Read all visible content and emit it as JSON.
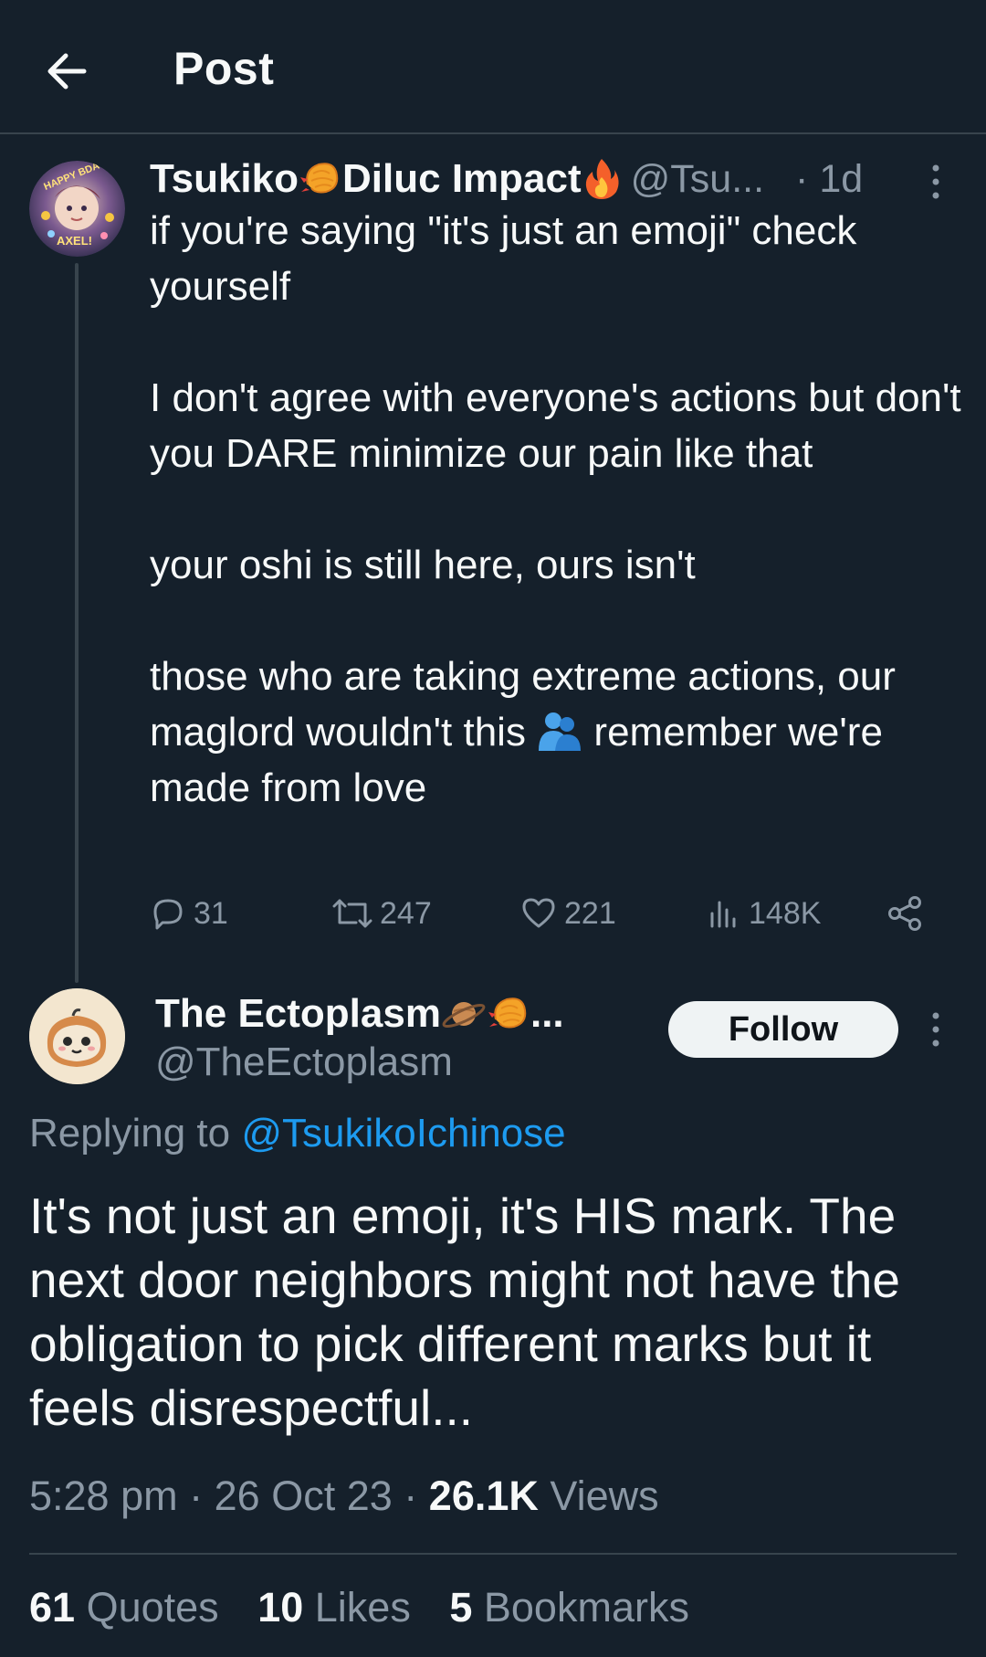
{
  "header": {
    "title": "Post"
  },
  "parent_tweet": {
    "display_name": "Tsukiko",
    "display_name_part2": "Diluc Impact",
    "handle": "@Tsu...",
    "time": "· 1d",
    "paragraphs": [
      "if you're saying \"it's just an emoji\" check yourself",
      "I don't agree with everyone's actions but don't you DARE minimize our pain like that",
      "your oshi is still here, ours isn't"
    ],
    "last_paragraph_before_emoji": "those who are taking extreme actions, our maglord wouldn't this",
    "last_paragraph_after_emoji": "remember we're made from love",
    "actions": {
      "replies": "31",
      "reposts": "247",
      "likes": "221",
      "views": "148K"
    },
    "avatar_text_top": "HAPPY BDAY",
    "avatar_text_bottom": "AXEL!"
  },
  "reply_tweet": {
    "display_name": "The Ectoplasm",
    "display_name_ellipsis": "...",
    "handle": "@TheEctoplasm",
    "follow_label": "Follow",
    "replying_prefix": "Replying to",
    "replying_to": "@TsukikoIchinose",
    "text": "It's not just an emoji, it's HIS mark. The next door neighbors might not have the obligation to pick different marks but it feels disrespectful...",
    "time": "5:28 pm",
    "date": "26 Oct 23",
    "views_count": "26.1K",
    "views_label": "Views",
    "sep": "·"
  },
  "stats": {
    "quotes_count": "61",
    "quotes_label": "Quotes",
    "likes_count": "10",
    "likes_label": "Likes",
    "bookmarks_count": "5",
    "bookmarks_label": "Bookmarks"
  },
  "colors": {
    "background": "#15202b",
    "text": "#f7f9f9",
    "secondary": "#8b98a5",
    "link": "#1d9bf0",
    "divider": "#38444d"
  },
  "icons": [
    "back-arrow-icon",
    "shrimp-emoji-icon",
    "fire-emoji-icon",
    "more-icon",
    "reply-icon",
    "repost-icon",
    "like-icon",
    "views-icon",
    "share-icon",
    "hug-emoji-icon",
    "planet-emoji-icon"
  ]
}
